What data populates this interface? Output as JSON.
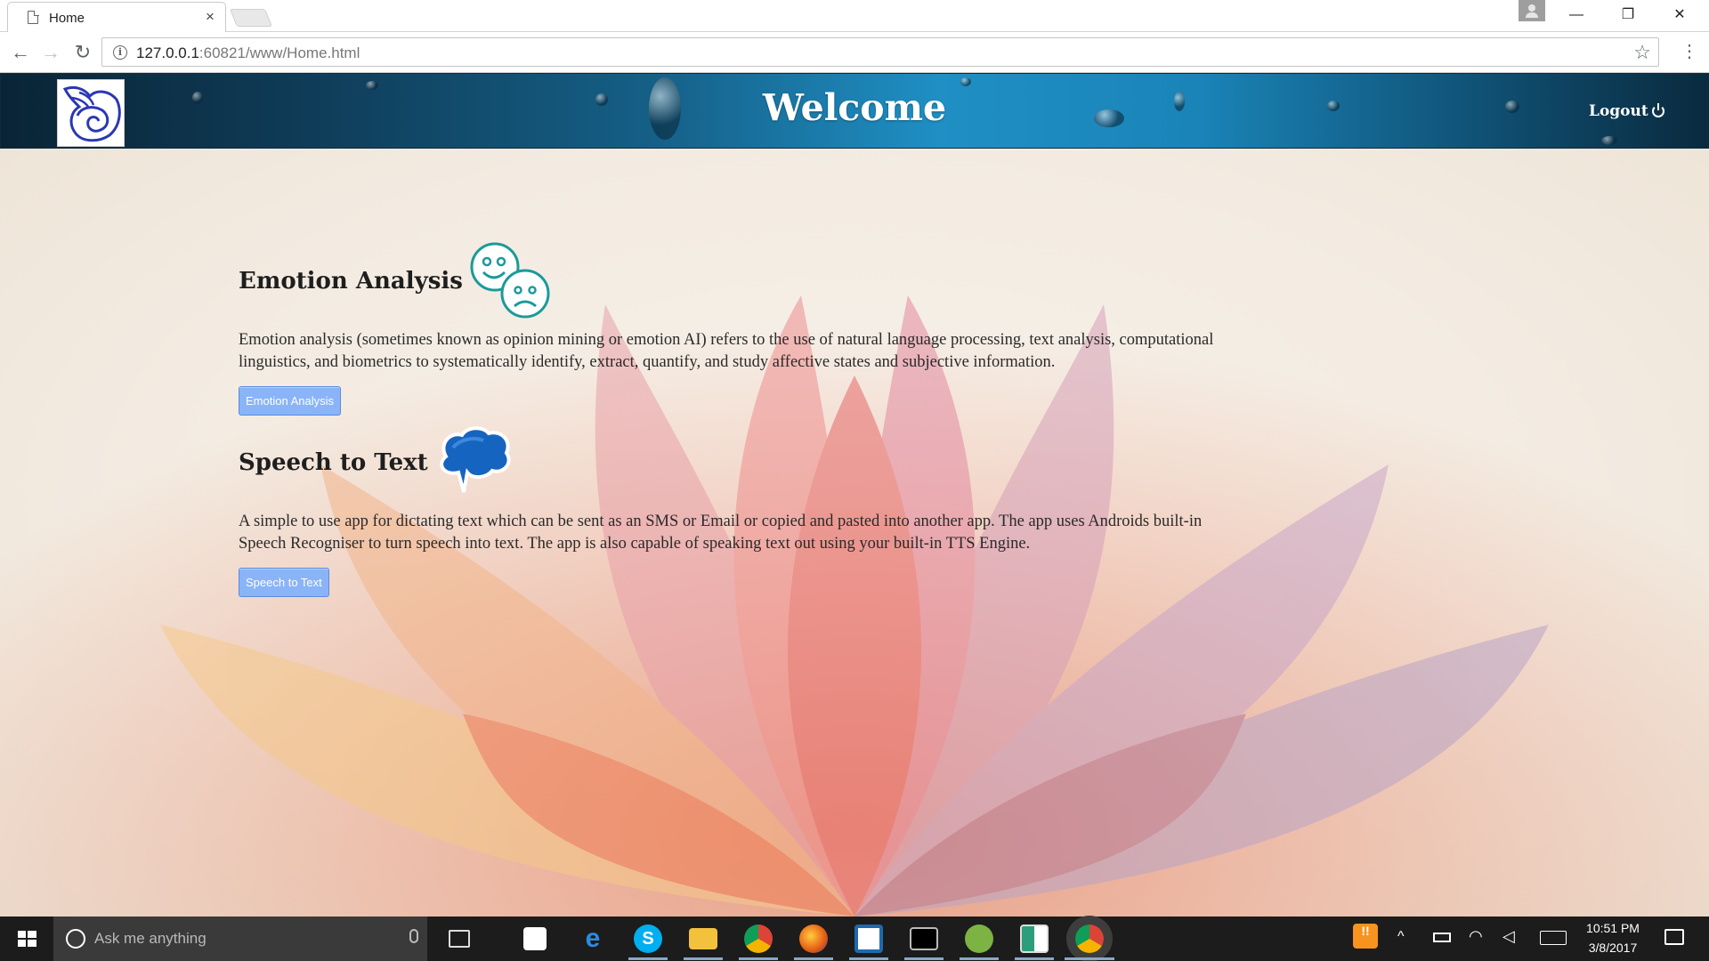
{
  "browser": {
    "tab_title": "Home",
    "tab_close": "×",
    "url_host": "127.0.0.1",
    "url_rest": ":60821/www/Home.html",
    "window_controls": [
      "—",
      "❐",
      "✕"
    ]
  },
  "header": {
    "title": "Welcome",
    "logout_label": "Logout",
    "logo_icon": "winged-logo-icon"
  },
  "sections": [
    {
      "heading": "Emotion Analysis",
      "icon": "emotion-faces-icon",
      "description": "Emotion analysis (sometimes known as opinion mining or emotion AI) refers to the use of natural language processing, text analysis, computational linguistics, and biometrics to systematically identify, extract, quantify, and study affective states and subjective information.",
      "button_label": "Emotion Analysis"
    },
    {
      "heading": "Speech to Text",
      "icon": "speech-bubble-icon",
      "description": "A simple to use app for dictating text which can be sent as an SMS or Email or copied and pasted into another app. The app uses Androids built-in Speech Recogniser to turn speech into text. The app is also capable of speaking text out using your built-in TTS Engine.",
      "button_label": "Speech to Text"
    }
  ],
  "taskbar": {
    "search_placeholder": "Ask me anything",
    "apps": [
      "task-view-icon",
      "store-icon",
      "edge-icon",
      "skype-icon",
      "file-explorer-icon",
      "chrome-icon",
      "firefox-icon",
      "bracket-app-icon",
      "terminal-icon",
      "android-studio-icon",
      "app-window-icon",
      "chrome-active-icon"
    ],
    "time": "10:51 PM",
    "date": "3/8/2017"
  },
  "colors": {
    "header_accent": "#1f8fc4",
    "button_bg": "#8ab4f8",
    "taskbar_bg": "#1c1c1c"
  }
}
